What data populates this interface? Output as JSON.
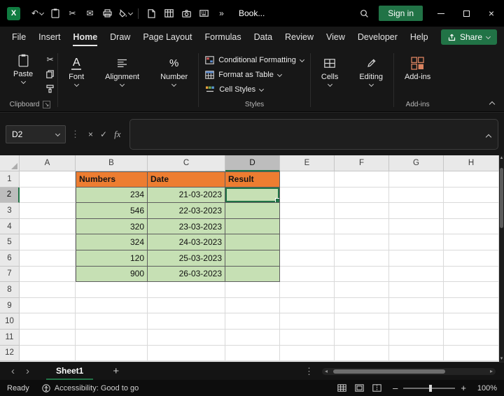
{
  "titlebar": {
    "title": "Book...",
    "sign_in_label": "Sign in"
  },
  "menu": {
    "items": [
      "File",
      "Insert",
      "Home",
      "Draw",
      "Page Layout",
      "Formulas",
      "Data",
      "Review",
      "View",
      "Developer",
      "Help"
    ],
    "active": "Home",
    "share_label": "Share"
  },
  "ribbon": {
    "clipboard": {
      "paste_label": "Paste",
      "group_label": "Clipboard"
    },
    "font": {
      "label": "Font"
    },
    "alignment": {
      "label": "Alignment"
    },
    "number": {
      "label": "Number"
    },
    "styles": {
      "buttons": [
        "Conditional Formatting",
        "Format as Table",
        "Cell Styles"
      ],
      "group_label": "Styles"
    },
    "cells": {
      "label": "Cells"
    },
    "editing": {
      "label": "Editing"
    },
    "addins": {
      "label": "Add-ins",
      "group_label": "Add-ins"
    }
  },
  "formula_bar": {
    "name_box": "D2",
    "formula": ""
  },
  "grid": {
    "columns": [
      "A",
      "B",
      "C",
      "D",
      "E",
      "F",
      "G",
      "H"
    ],
    "row_count": 12,
    "selected": "D2",
    "header_range": [
      "B1",
      "D1"
    ],
    "data_range": [
      "B2",
      "D7"
    ],
    "cells": {
      "B1": "Numbers",
      "C1": "Date",
      "D1": "Result",
      "B2": "234",
      "C2": "21-03-2023",
      "B3": "546",
      "C3": "22-03-2023",
      "B4": "320",
      "C4": "23-03-2023",
      "B5": "324",
      "C5": "24-03-2023",
      "B6": "120",
      "C6": "25-03-2023",
      "B7": "900",
      "C7": "26-03-2023"
    }
  },
  "tab_bar": {
    "sheets": [
      "Sheet1"
    ],
    "active": "Sheet1"
  },
  "status_bar": {
    "ready": "Ready",
    "accessibility": "Accessibility: Good to go",
    "zoom": "100%"
  },
  "colors": {
    "accent": "#217346",
    "header_fill": "#ED7D31",
    "data_fill": "#C6E0B4"
  },
  "icons": {
    "undo": "↶",
    "cut": "✂",
    "mail": "✉",
    "overflow": "»",
    "kebab": "⋮",
    "dots": "⋮",
    "close": "×",
    "cancel": "×",
    "enter": "✓",
    "fx": "fx",
    "font_a": "A",
    "percent": "%",
    "launcher": "↘",
    "prev": "‹",
    "next": "›",
    "scroll_left": "◂",
    "scroll_right": "▸",
    "scroll_up": "▲",
    "scroll_down": "▼",
    "add_sheet": "+",
    "zoom_out": "–",
    "zoom_in": "+"
  }
}
